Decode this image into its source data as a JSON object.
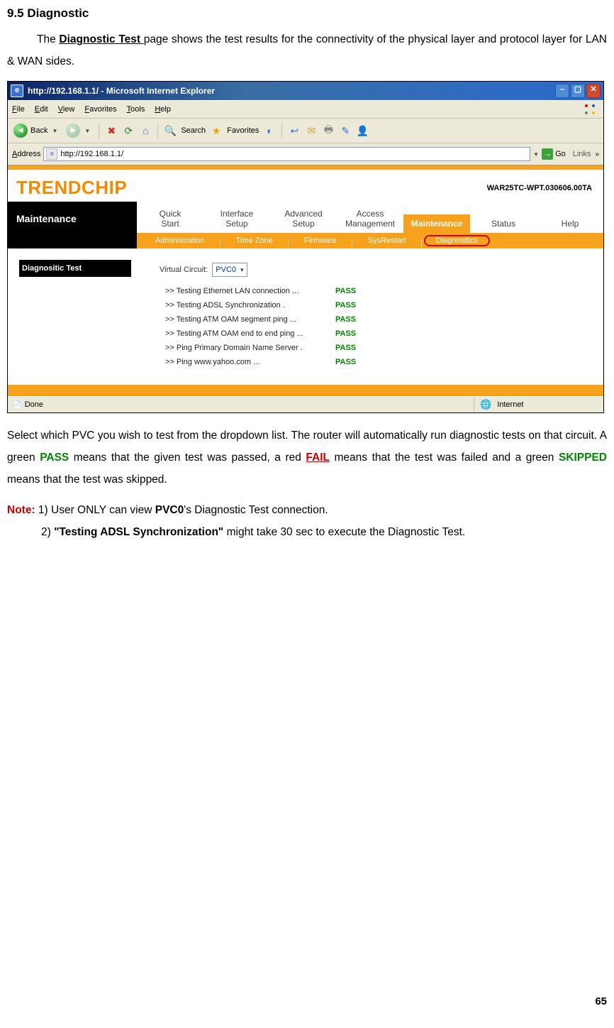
{
  "doc": {
    "heading": "9.5 Diagnostic",
    "intro_pre": "The ",
    "intro_link": "Diagnostic Test ",
    "intro_post": "page shows the test results for the connectivity of the physical layer and protocol layer for LAN & WAN sides.",
    "p2a": "Select which PVC you wish to test from the dropdown list. The router will automatically run diagnostic tests on that circuit. A green ",
    "p2_pass": "PASS",
    "p2b": " means that the given test was passed, a red ",
    "p2_fail": "FAIL",
    "p2c": " means that the test was failed and a green ",
    "p2_skip": "SKIPPED",
    "p2d": " means that the test was skipped.",
    "note_label": "Note:",
    "note1a": " 1) User ONLY can view ",
    "note1b": "PVC0",
    "note1c": "'s Diagnostic Test connection.",
    "note2a": "2) ",
    "note2b": "\"Testing ADSL Synchronization\"",
    "note2c": " might take 30 sec to execute the Diagnostic Test.",
    "page_num": "65"
  },
  "browser": {
    "title": "http://192.168.1.1/ - Microsoft Internet Explorer",
    "menu": {
      "file": "File",
      "edit": "Edit",
      "view": "View",
      "favorites": "Favorites",
      "tools": "Tools",
      "help": "Help"
    },
    "back": "Back",
    "search": "Search",
    "favorites": "Favorites",
    "address_label": "Address",
    "url": "http://192.168.1.1/",
    "go": "Go",
    "links": "Links",
    "status_done": "Done",
    "status_zone": "Internet"
  },
  "router": {
    "logo": "TRENDCHIP",
    "fw": "WAR25TC-WPT.030606.00TA",
    "side_label": "Maintenance",
    "tabs1": [
      "Quick\nStart",
      "Interface\nSetup",
      "Advanced\nSetup",
      "Access\nManagement",
      "Maintenance",
      "Status",
      "Help"
    ],
    "active_tab1": 4,
    "tabs2": [
      "Administration",
      "Time Zone",
      "Firmware",
      "SysRestart",
      "Diagnositics"
    ],
    "active_tab2_highlight": 4,
    "section": "Diagnositic Test",
    "vc_label": "Virtual Circuit:",
    "vc_value": "PVC0",
    "tests": [
      {
        "name": ">> Testing Ethernet LAN connection ...",
        "result": "PASS"
      },
      {
        "name": ">> Testing ADSL Synchronization .",
        "result": "PASS"
      },
      {
        "name": ">> Testing ATM OAM segment ping ...",
        "result": "PASS"
      },
      {
        "name": ">> Testing ATM OAM end to end ping ...",
        "result": "PASS"
      },
      {
        "name": ">> Ping Primary Domain Name Server .",
        "result": "PASS"
      },
      {
        "name": ">> Ping www.yahoo.com ...",
        "result": "PASS"
      }
    ]
  }
}
